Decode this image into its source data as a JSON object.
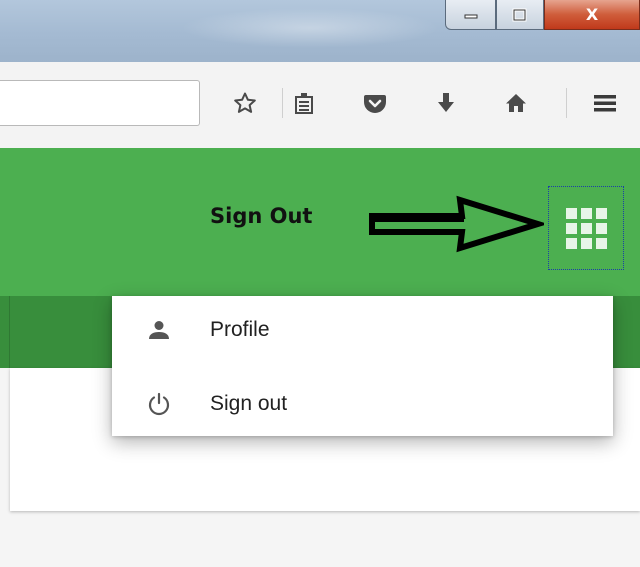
{
  "window": {
    "minimize_icon": "minimize-icon",
    "restore_icon": "restore-icon",
    "close_label": "X"
  },
  "toolbar": {
    "url_value": "",
    "icons": [
      "bookmark-star-icon",
      "reader-view-icon",
      "pocket-icon",
      "download-icon",
      "home-icon",
      "hamburger-menu-icon"
    ]
  },
  "header": {
    "annotation_text": "Sign Out",
    "apps_icon": "apps-grid-icon",
    "color": "#4caf50",
    "band_color": "#388e3c"
  },
  "menu": {
    "items": [
      {
        "label": "Profile",
        "icon": "person-icon"
      },
      {
        "label": "Sign out",
        "icon": "power-icon"
      }
    ]
  }
}
